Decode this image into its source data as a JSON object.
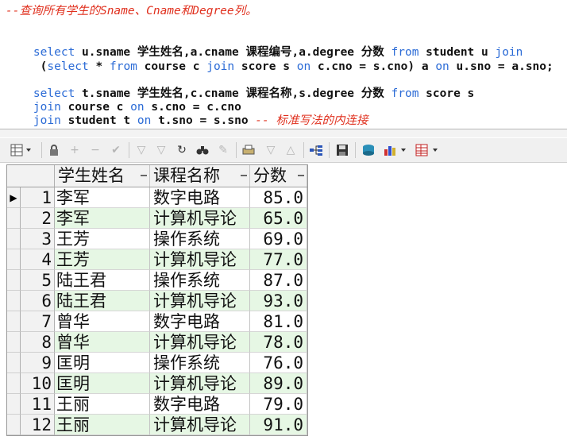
{
  "editor": {
    "comment_line": "--查询所有学生的Sname、Cname和Degree列。",
    "query1": {
      "select": "select",
      "part1": " u.sname ",
      "alias1": "学生姓名",
      "part2": ",a.cname ",
      "alias2": "课程编号",
      "part3": ",a.degree ",
      "alias3": "分数",
      "from": " from",
      "table1": " student u ",
      "join": "join",
      "line2_open": " (",
      "select2": "select",
      "star": " * ",
      "from2": "from",
      "course": " course c ",
      "join2": "join",
      "score": " score s ",
      "on": "on",
      "cond1": " c.cno = s.cno) a ",
      "on2": "on",
      "cond2": " u.sno = a.sno;"
    },
    "query2": {
      "select": "select",
      "part1": " t.sname ",
      "alias1": "学生姓名",
      "part2": ",c.cname ",
      "alias2": "课程名称",
      "part3": ",s.degree ",
      "alias3": "分数",
      "from": " from",
      "table1": " score s",
      "join1": "join",
      "course": " course c ",
      "on1": "on",
      "cond1": " s.cno = c.cno",
      "join2": "join",
      "student": " student t ",
      "on2": "on",
      "cond2": " t.sno = s.sno ",
      "comment": "-- 标准写法的内连接"
    }
  },
  "toolbar": {
    "icons": [
      "grid-menu-icon",
      "lock-icon",
      "add-icon",
      "remove-icon",
      "check-icon",
      "filter-down-icon",
      "filter-clear-icon",
      "refresh-icon",
      "find-icon",
      "eraser-icon",
      "print-icon",
      "arrow-down-icon",
      "arrow-up-icon",
      "tree-icon",
      "save-icon",
      "database-icon",
      "chart-icon",
      "table-icon"
    ]
  },
  "grid": {
    "columns": [
      "学生姓名",
      "课程名称",
      "分数"
    ],
    "current_row_marker": "▶",
    "rows": [
      {
        "n": "1",
        "name": "李军",
        "course": "数字电路",
        "score": "85.0"
      },
      {
        "n": "2",
        "name": "李军",
        "course": "计算机导论",
        "score": "65.0"
      },
      {
        "n": "3",
        "name": "王芳",
        "course": "操作系统",
        "score": "69.0"
      },
      {
        "n": "4",
        "name": "王芳",
        "course": "计算机导论",
        "score": "77.0"
      },
      {
        "n": "5",
        "name": "陆王君",
        "course": "操作系统",
        "score": "87.0"
      },
      {
        "n": "6",
        "name": "陆王君",
        "course": "计算机导论",
        "score": "93.0"
      },
      {
        "n": "7",
        "name": "曾华",
        "course": "数字电路",
        "score": "81.0"
      },
      {
        "n": "8",
        "name": "曾华",
        "course": "计算机导论",
        "score": "78.0"
      },
      {
        "n": "9",
        "name": "匡明",
        "course": "操作系统",
        "score": "76.0"
      },
      {
        "n": "10",
        "name": "匡明",
        "course": "计算机导论",
        "score": "89.0"
      },
      {
        "n": "11",
        "name": "王丽",
        "course": "数字电路",
        "score": "79.0"
      },
      {
        "n": "12",
        "name": "王丽",
        "course": "计算机导论",
        "score": "91.0"
      }
    ]
  }
}
